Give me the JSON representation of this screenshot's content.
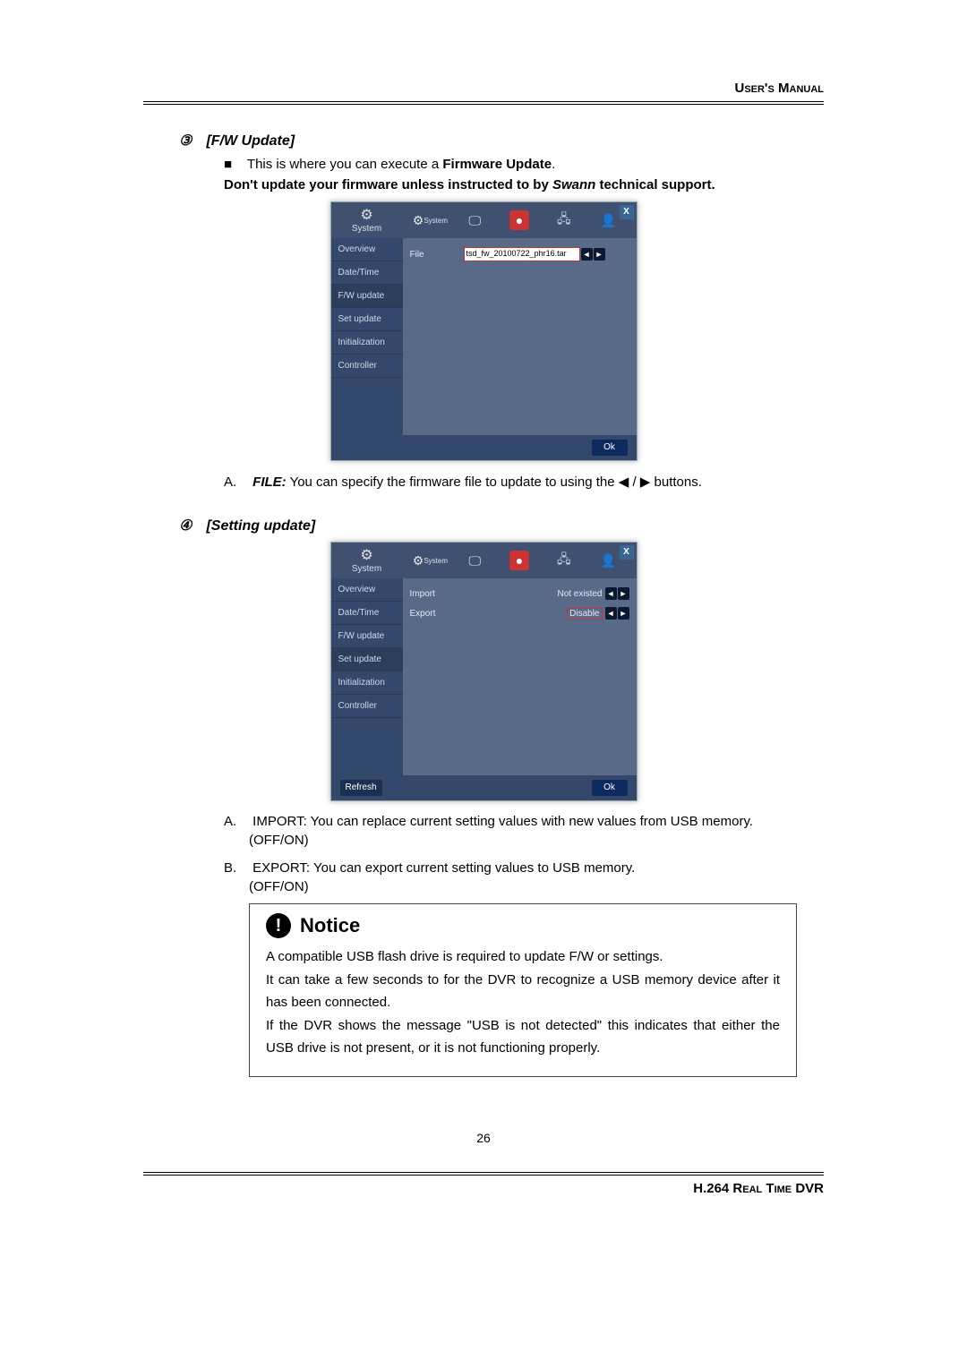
{
  "header_right": "User's Manual",
  "footer_right": "H.264 Real Time DVR",
  "page_number": "26",
  "sections": {
    "fw": {
      "marker": "③",
      "title": "[F/W Update]",
      "bullet_square": "■",
      "bullet_text_prefix": "This is where you can execute a ",
      "bullet_text_bold": "Firmware Update",
      "bullet_text_suffix": ".",
      "warn_prefix": "Don't update your firmware unless instructed to by ",
      "warn_italic": "Swann",
      "warn_suffix": " technical support.",
      "letter_a_label": "A.",
      "letter_a_ital": "FILE:",
      "letter_a_text": " You can specify the firmware file to update to using the ",
      "letter_a_glyph1": "◀",
      "letter_a_slash": " / ",
      "letter_a_glyph2": "▶",
      "letter_a_end": " buttons."
    },
    "set": {
      "marker": "④",
      "title": "[Setting update]",
      "a_label": "A.",
      "a_text": "IMPORT: You can replace current setting values with new values from USB memory.",
      "a_onoff": "(OFF/ON)",
      "b_label": "B.",
      "b_text": "EXPORT: You can export current setting values to USB memory.",
      "b_onoff": "(OFF/ON)"
    }
  },
  "notice": {
    "icon": "!",
    "heading": "Notice",
    "line1": "A compatible USB flash drive is required to update F/W or settings.",
    "line2": "It can take a few seconds to for the DVR to recognize a USB memory device after it has been connected.",
    "line3": "If the DVR shows the message \"USB is not detected\" this indicates that either the USB drive is not present, or it is not functioning properly."
  },
  "dvr_common": {
    "top_label": "System",
    "close": "X",
    "side": [
      "Overview",
      "Date/Time",
      "F/W update",
      "Set update",
      "Initialization",
      "Controller"
    ],
    "ok": "Ok",
    "arrow_left": "◄",
    "arrow_right": "►"
  },
  "dvr1": {
    "row_label": "File",
    "file_value": "tsd_fw_20100722_phr16.tar"
  },
  "dvr2": {
    "import_label": "Import",
    "import_value": "Not existed",
    "export_label": "Export",
    "export_value": "Disable",
    "refresh": "Refresh"
  }
}
